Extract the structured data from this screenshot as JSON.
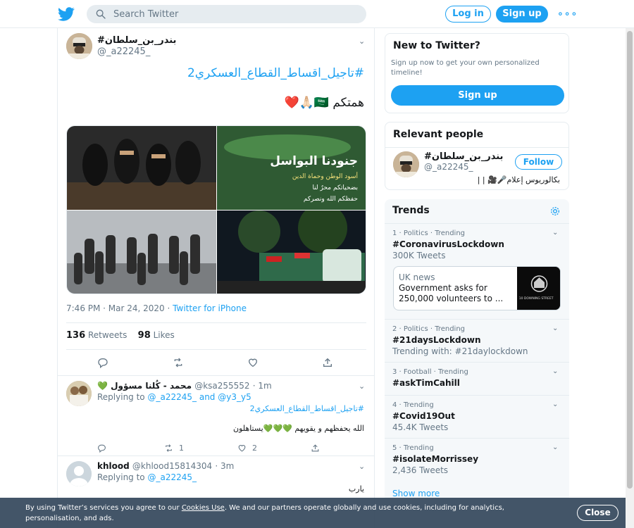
{
  "search": {
    "placeholder": "Search Twitter"
  },
  "topbar": {
    "login": "Log in",
    "signup": "Sign up"
  },
  "tweet": {
    "name": "#بندر_بن_سلطان",
    "handle": "@_a22245_",
    "hashtag": "#تاجيل_اقساط_القطاع_العسكري2",
    "text": "همتكم 🇸🇦🙏🏻❤️",
    "timestamp": "7:46 PM · Mar 24, 2020",
    "source": "Twitter for iPhone",
    "retweets": "136",
    "retweets_label": "Retweets",
    "likes": "98",
    "likes_label": "Likes",
    "media_texts": [
      "جنودنا البواسل",
      "أسود الوطن وحماة الدين",
      "بضحياتكم محرٌ لنا",
      "حفظكم الله ونصركم"
    ]
  },
  "replies": [
    {
      "name": "💚 محمد - كُلنا مسؤول",
      "handle": "@ksa255552",
      "time": "1m",
      "replying_prefix": "Replying to",
      "replying_to": "@_a22245_",
      "replying_and": "and",
      "replying_to2": "@y3_y5",
      "hashtag": "#تاجيل_اقساط_القطاع_العسكري2",
      "text": "الله يحفظهم و يقويهم 💚💚💚يستاهلون",
      "retweets": "1",
      "likes": "2"
    },
    {
      "name": "khlood",
      "handle": "@khlood15814304",
      "time": "3m",
      "replying_prefix": "Replying to",
      "replying_to": "@_a22245_",
      "text": "يارب"
    }
  ],
  "new_to_twitter": {
    "title": "New to Twitter?",
    "desc": "Sign up now to get your own personalized timeline!",
    "button": "Sign up"
  },
  "relevant": {
    "title": "Relevant people",
    "name": "#بندر_بن_سلطان",
    "handle": "@_a22245_",
    "follow": "Follow",
    "bio": "بكالوريوس إعلام🎤🎥 | |"
  },
  "trends": {
    "title": "Trends",
    "items": [
      {
        "meta": "1 · Politics · Trending",
        "title": "#CoronavirusLockdown",
        "sub": "300K Tweets"
      },
      {
        "meta": "2 · Politics · Trending",
        "title": "#21daysLockdown",
        "sub": "Trending with: #21daylockdown"
      },
      {
        "meta": "3 · Football · Trending",
        "title": "#askTimCahill",
        "sub": ""
      },
      {
        "meta": "4 · Trending",
        "title": "#Covid19Out",
        "sub": "45.4K Tweets"
      },
      {
        "meta": "5 · Trending",
        "title": "#isolateMorrissey",
        "sub": "2,436 Tweets"
      }
    ],
    "news": {
      "source": "UK news",
      "headline": "Government asks for 250,000 volunteers to ..."
    },
    "news_image_text": "10 DOWNING STREET",
    "show_more": "Show more"
  },
  "cookie": {
    "text_before": "By using Twitter’s services you agree to our ",
    "link": "Cookies Use",
    "text_after": ". We and our partners operate globally and use cookies, including for analytics, personalisation, and ads.",
    "close": "Close"
  },
  "colors": {
    "accent": "#1da1f2",
    "text": "#14171a",
    "muted": "#657786",
    "border": "#e6ecf0"
  }
}
